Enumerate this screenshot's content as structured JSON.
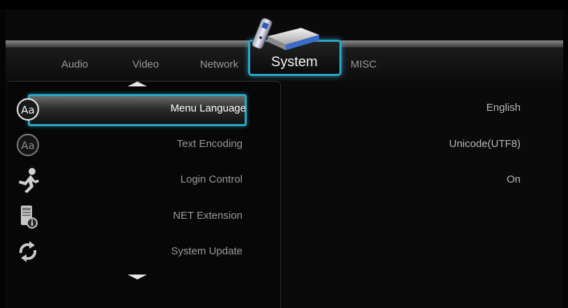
{
  "tabs": {
    "audio": "Audio",
    "video": "Video",
    "network": "Network",
    "system": "System",
    "misc": "MISC"
  },
  "menu": {
    "items": [
      {
        "label": "Menu Language",
        "icon": "font-aa-icon",
        "value": "English"
      },
      {
        "label": "Text Encoding",
        "icon": "font-aa-dim-icon",
        "value": "Unicode(UTF8)"
      },
      {
        "label": "Login Control",
        "icon": "running-man-icon",
        "value": "On"
      },
      {
        "label": "NET Extension",
        "icon": "device-info-icon",
        "value": ""
      },
      {
        "label": "System Update",
        "icon": "refresh-arrows-icon",
        "value": ""
      }
    ]
  },
  "colors": {
    "accent": "#28a8c8",
    "background": "#050505",
    "text": "#9a9a9a",
    "selected_text": "#ffffff"
  }
}
